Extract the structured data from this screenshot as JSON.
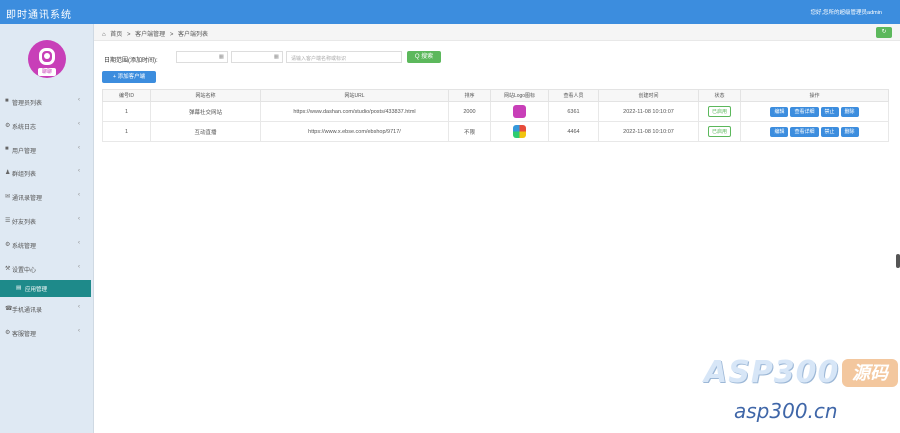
{
  "app": {
    "title": "即时通讯系统",
    "user": "您好,您所的超级管理员admin"
  },
  "sidebar": {
    "avatar_tag": "聊聊",
    "items": [
      {
        "label": "管理员列表",
        "icon": "user-icon",
        "glyph": "■",
        "chev": "‹"
      },
      {
        "label": "系统日志",
        "icon": "gear-icon",
        "glyph": "⚙",
        "chev": "‹"
      },
      {
        "label": "用户管理",
        "icon": "user-icon",
        "glyph": "■",
        "chev": "‹"
      },
      {
        "label": "群组列表",
        "icon": "users-icon",
        "glyph": "♟",
        "chev": "‹"
      },
      {
        "label": "通讯录管理",
        "icon": "contacts-icon",
        "glyph": "✉",
        "chev": "‹"
      },
      {
        "label": "好友列表",
        "icon": "list-icon",
        "glyph": "☰",
        "chev": "‹"
      },
      {
        "label": "系统管理",
        "icon": "gear-icon",
        "glyph": "⚙",
        "chev": "‹"
      },
      {
        "label": "设置中心",
        "icon": "settings-icon",
        "glyph": "⚒",
        "chev": "‹"
      }
    ],
    "sub_item": {
      "label": "应用管理",
      "icon": "app-icon",
      "glyph": "▤"
    },
    "items2": [
      {
        "label": "手机通讯录",
        "icon": "phone-icon",
        "glyph": "☎",
        "chev": "‹"
      },
      {
        "label": "客服管理",
        "icon": "service-icon",
        "glyph": "⚙",
        "chev": "‹"
      }
    ]
  },
  "breadcrumb": {
    "home_icon": "⌂",
    "items": [
      "首页",
      ">",
      "客户端管理",
      ">",
      "客户端列表"
    ]
  },
  "toolbar": {
    "refresh": "↻"
  },
  "filter": {
    "label": "日期范围(添加时间):",
    "date_from": "",
    "date_to": "",
    "cal_icon": "▦",
    "search_placeholder": "请输入客户端名称或标识",
    "search_btn": "Q 搜索",
    "add_btn": "+ 添加客户端"
  },
  "table": {
    "headers": [
      "编号ID",
      "网站名称",
      "网站URL",
      "排序",
      "网站Logo图标",
      "查看人员",
      "创建时间",
      "状态",
      "操作"
    ],
    "rows": [
      {
        "id": "1",
        "name": "弹幕社交网站",
        "url": "https://www.dashan.com/studio/posts/433837.html",
        "sort": "2000",
        "logo_color": "#c83fb8",
        "viewers": "6361",
        "created": "2022-11-08 10:10:07",
        "status": "已启用",
        "ops": [
          "编辑",
          "查看详细",
          "禁止",
          "删除"
        ]
      },
      {
        "id": "1",
        "name": "互动直播",
        "url": "https://www.x.ebse.com/ebshop/9717/",
        "sort": "不限",
        "logo_color": "#f0a020",
        "viewers": "4464",
        "created": "2022-11-08 10:10:07",
        "status": "已启用",
        "ops": [
          "编辑",
          "查看详细",
          "禁止",
          "删除"
        ]
      }
    ]
  },
  "watermark": {
    "main": "ASP300",
    "box": "源码",
    "sub": "asp300.cn"
  }
}
